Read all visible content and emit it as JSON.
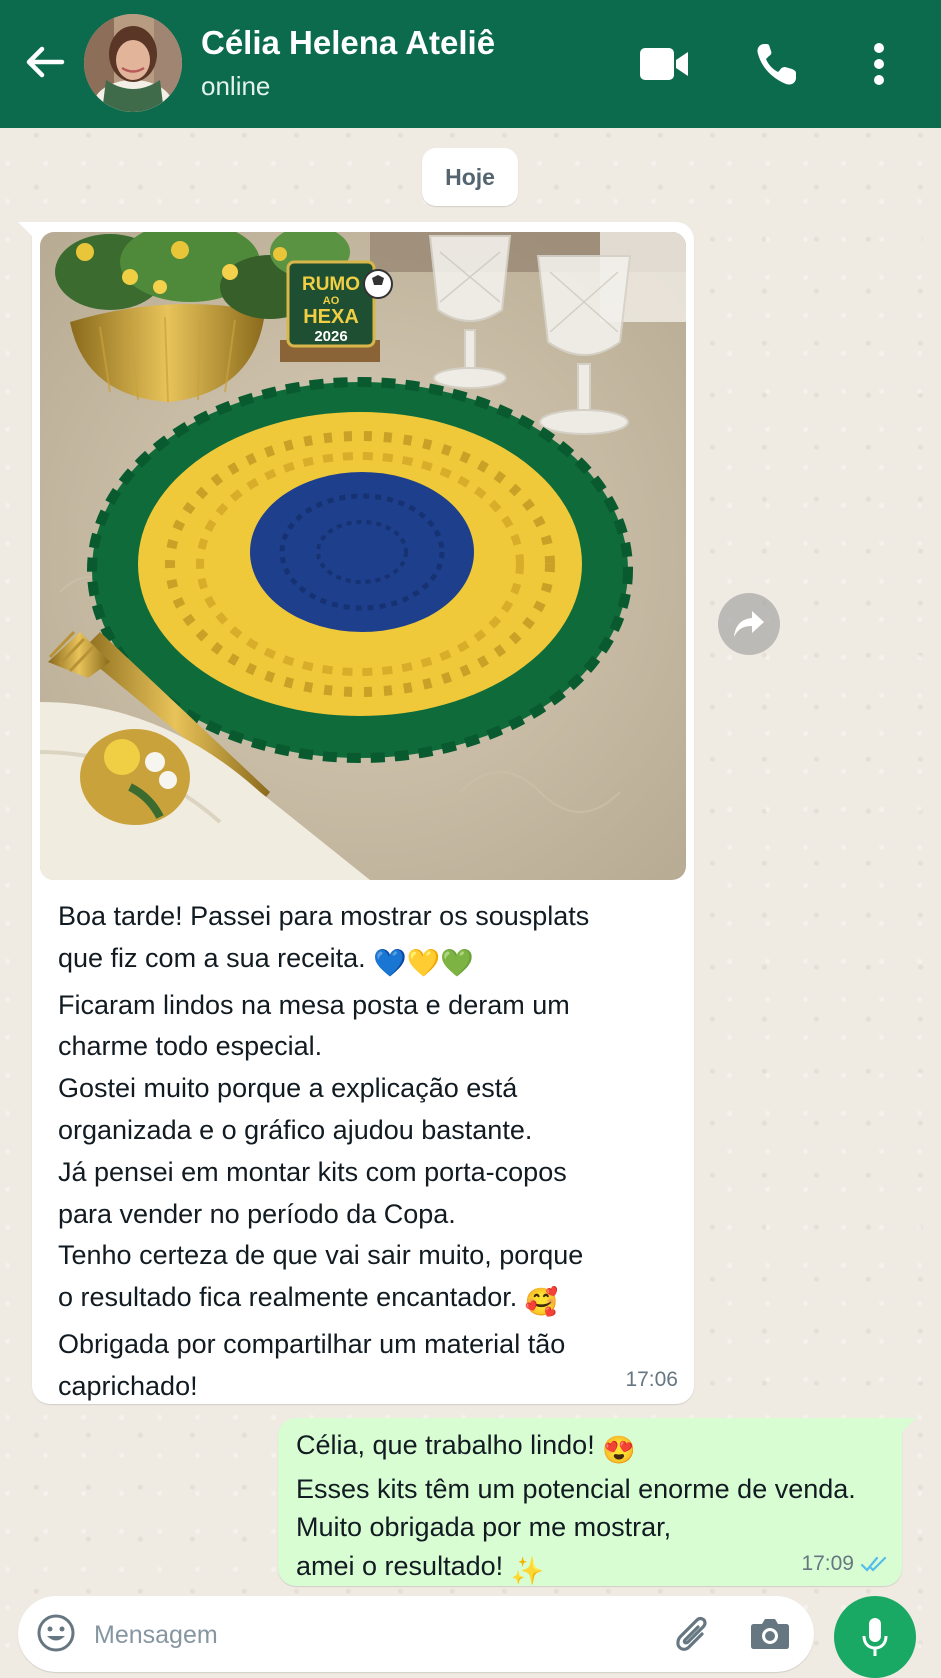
{
  "header": {
    "contact_name": "Célia Helena Ateliê",
    "status": "online",
    "background_color": "#0b6b4c"
  },
  "chat": {
    "date_chip": "Hoje",
    "messages": [
      {
        "direction": "incoming",
        "has_image": true,
        "image_text": [
          "RUMO",
          "AO",
          "HEXA",
          "2026"
        ],
        "lines": [
          "Boa tarde! Passei para mostrar os sousplats",
          "que fiz com a sua receita.",
          "Ficaram lindos na mesa posta e deram um",
          "charme todo especial.",
          "Gostei muito porque a explicação está",
          "organizada e o gráfico ajudou bastante.",
          "Já pensei em montar kits com porta-copos",
          "para vender no período da Copa.",
          "Tenho certeza de que vai sair muito, porque",
          "o resultado fica realmente encantador.",
          "Obrigada por compartilhar um material tão",
          "caprichado!"
        ],
        "emojis_line2": "💙💛💚",
        "emoji_line10": "🥰",
        "time": "17:06"
      },
      {
        "direction": "outgoing",
        "lines": [
          "Célia, que trabalho lindo!",
          "Esses kits têm um potencial enorme de venda.",
          "Muito obrigada por me mostrar,",
          "amei o resultado!"
        ],
        "emoji_line1": "😍",
        "emoji_line4": "✨",
        "time": "17:09",
        "read_status": "read"
      }
    ]
  },
  "composer": {
    "placeholder": "Mensagem",
    "icons": [
      "emoji-icon",
      "paperclip-icon",
      "camera-icon",
      "microphone-icon"
    ]
  },
  "colors": {
    "outgoing_bubble": "#d9fdd3",
    "incoming_bubble": "#ffffff",
    "mic_button": "#1aa865",
    "read_ticks": "#53bdeb"
  }
}
